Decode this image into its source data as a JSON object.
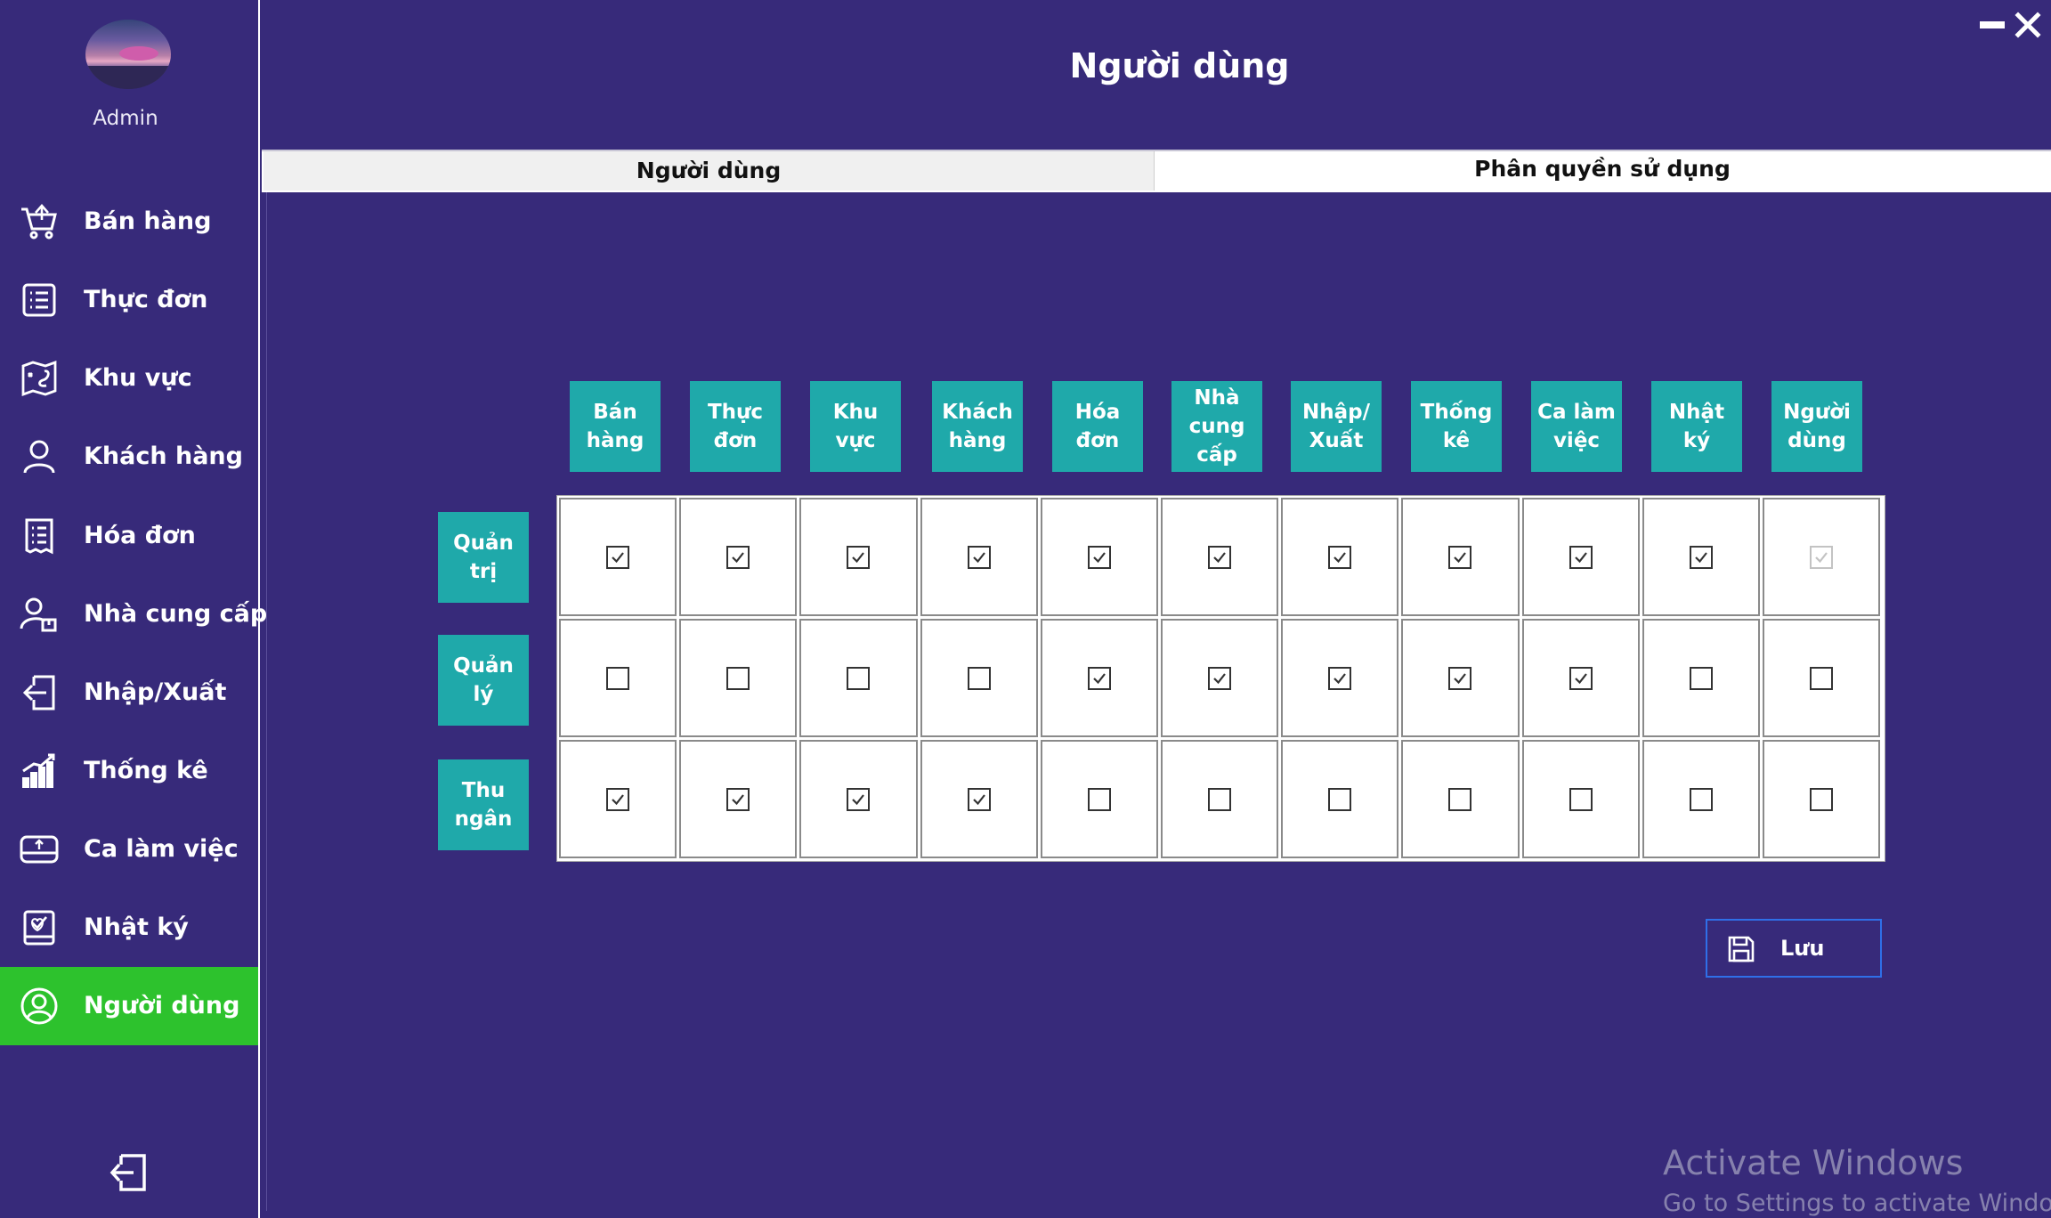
{
  "sidebar": {
    "user_name": "Admin",
    "items": [
      {
        "label": "Bán hàng",
        "icon": "cart-icon"
      },
      {
        "label": "Thực đơn",
        "icon": "menu-list-icon"
      },
      {
        "label": "Khu vực",
        "icon": "map-icon"
      },
      {
        "label": "Khách hàng",
        "icon": "user-icon"
      },
      {
        "label": "Hóa đơn",
        "icon": "invoice-icon"
      },
      {
        "label": "Nhà cung cấp",
        "icon": "supplier-icon"
      },
      {
        "label": "Nhập/Xuất",
        "icon": "import-export-icon"
      },
      {
        "label": "Thống kê",
        "icon": "chart-icon"
      },
      {
        "label": "Ca làm việc",
        "icon": "shift-icon"
      },
      {
        "label": "Nhật ký",
        "icon": "journal-icon"
      },
      {
        "label": "Người dùng",
        "icon": "user-circle-icon"
      }
    ],
    "active_index": 10,
    "active_color": "#2dc22d"
  },
  "header": {
    "title": "Người dùng"
  },
  "tabs": [
    {
      "label": "Người dùng"
    },
    {
      "label": "Phân quyền sử dụng"
    }
  ],
  "permissions": {
    "columns": [
      "Bán hàng",
      "Thực đơn",
      "Khu vực",
      "Khách hàng",
      "Hóa đơn",
      "Nhà cung cấp",
      "Nhập/ Xuất",
      "Thống kê",
      "Ca làm việc",
      "Nhật ký",
      "Người dùng"
    ],
    "rows": [
      {
        "label": "Quản trị",
        "values": [
          true,
          true,
          true,
          true,
          true,
          true,
          true,
          true,
          true,
          true,
          true
        ],
        "disabled": [
          false,
          false,
          false,
          false,
          false,
          false,
          false,
          false,
          false,
          false,
          true
        ]
      },
      {
        "label": "Quản lý",
        "values": [
          false,
          false,
          false,
          false,
          true,
          true,
          true,
          true,
          true,
          false,
          false
        ],
        "disabled": [
          false,
          false,
          false,
          false,
          false,
          false,
          false,
          false,
          false,
          false,
          false
        ]
      },
      {
        "label": "Thu ngân",
        "values": [
          true,
          true,
          true,
          true,
          false,
          false,
          false,
          false,
          false,
          false,
          false
        ],
        "disabled": [
          false,
          false,
          false,
          false,
          false,
          false,
          false,
          false,
          false,
          false,
          false
        ]
      }
    ]
  },
  "actions": {
    "save_label": "Lưu"
  },
  "watermark": {
    "line1": "Activate Windows",
    "line2": "Go to Settings to activate Windows."
  },
  "colors": {
    "background": "#372a7a",
    "header_teal": "#1fa9aa",
    "active_green": "#2dc22d",
    "save_border": "#2f6fe8"
  }
}
